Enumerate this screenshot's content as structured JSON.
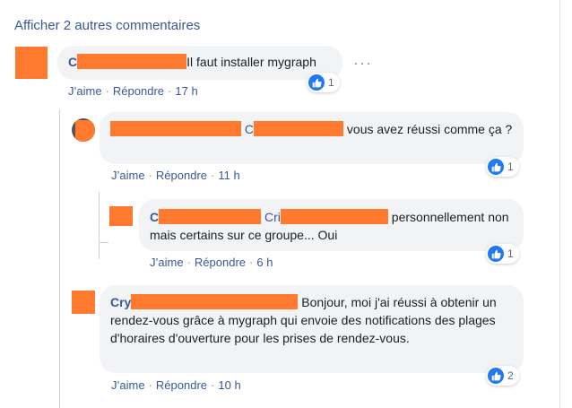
{
  "show_more": {
    "label": "Afficher 2 autres commentaires"
  },
  "icons": {
    "like": "thumbs-up-icon",
    "more": "more-options-icon"
  },
  "colors": {
    "link": "#385898",
    "bubble": "#f2f3f5",
    "redaction": "#ff7a2e",
    "like": "#2078f4"
  },
  "comments": [
    {
      "author_visible": "C",
      "text": "Il faut installer mygraph",
      "like_label": "J’aime",
      "reply_label": "Répondre",
      "time": "17 h",
      "reactions": "1"
    },
    {
      "mention_visible": "C",
      "text": "vous avez réussi comme ça ?",
      "like_label": "J’aime",
      "reply_label": "Répondre",
      "time": "11 h",
      "reactions": "1"
    },
    {
      "author_visible": "C",
      "mention_visible": "Cri",
      "text": "personnellement non mais certains sur ce groupe... Oui",
      "like_label": "J’aime",
      "reply_label": "Répondre",
      "time": "6 h",
      "reactions": "1"
    },
    {
      "author_visible": "Cry",
      "text": "Bonjour, moi j'ai réussi à obtenir un rendez-vous grâce à mygraph qui envoie des notifications des plages d'horaires d'ouverture pour les prises de rendez-vous.",
      "like_label": "J’aime",
      "reply_label": "Répondre",
      "time": "10 h",
      "reactions": "2"
    }
  ]
}
